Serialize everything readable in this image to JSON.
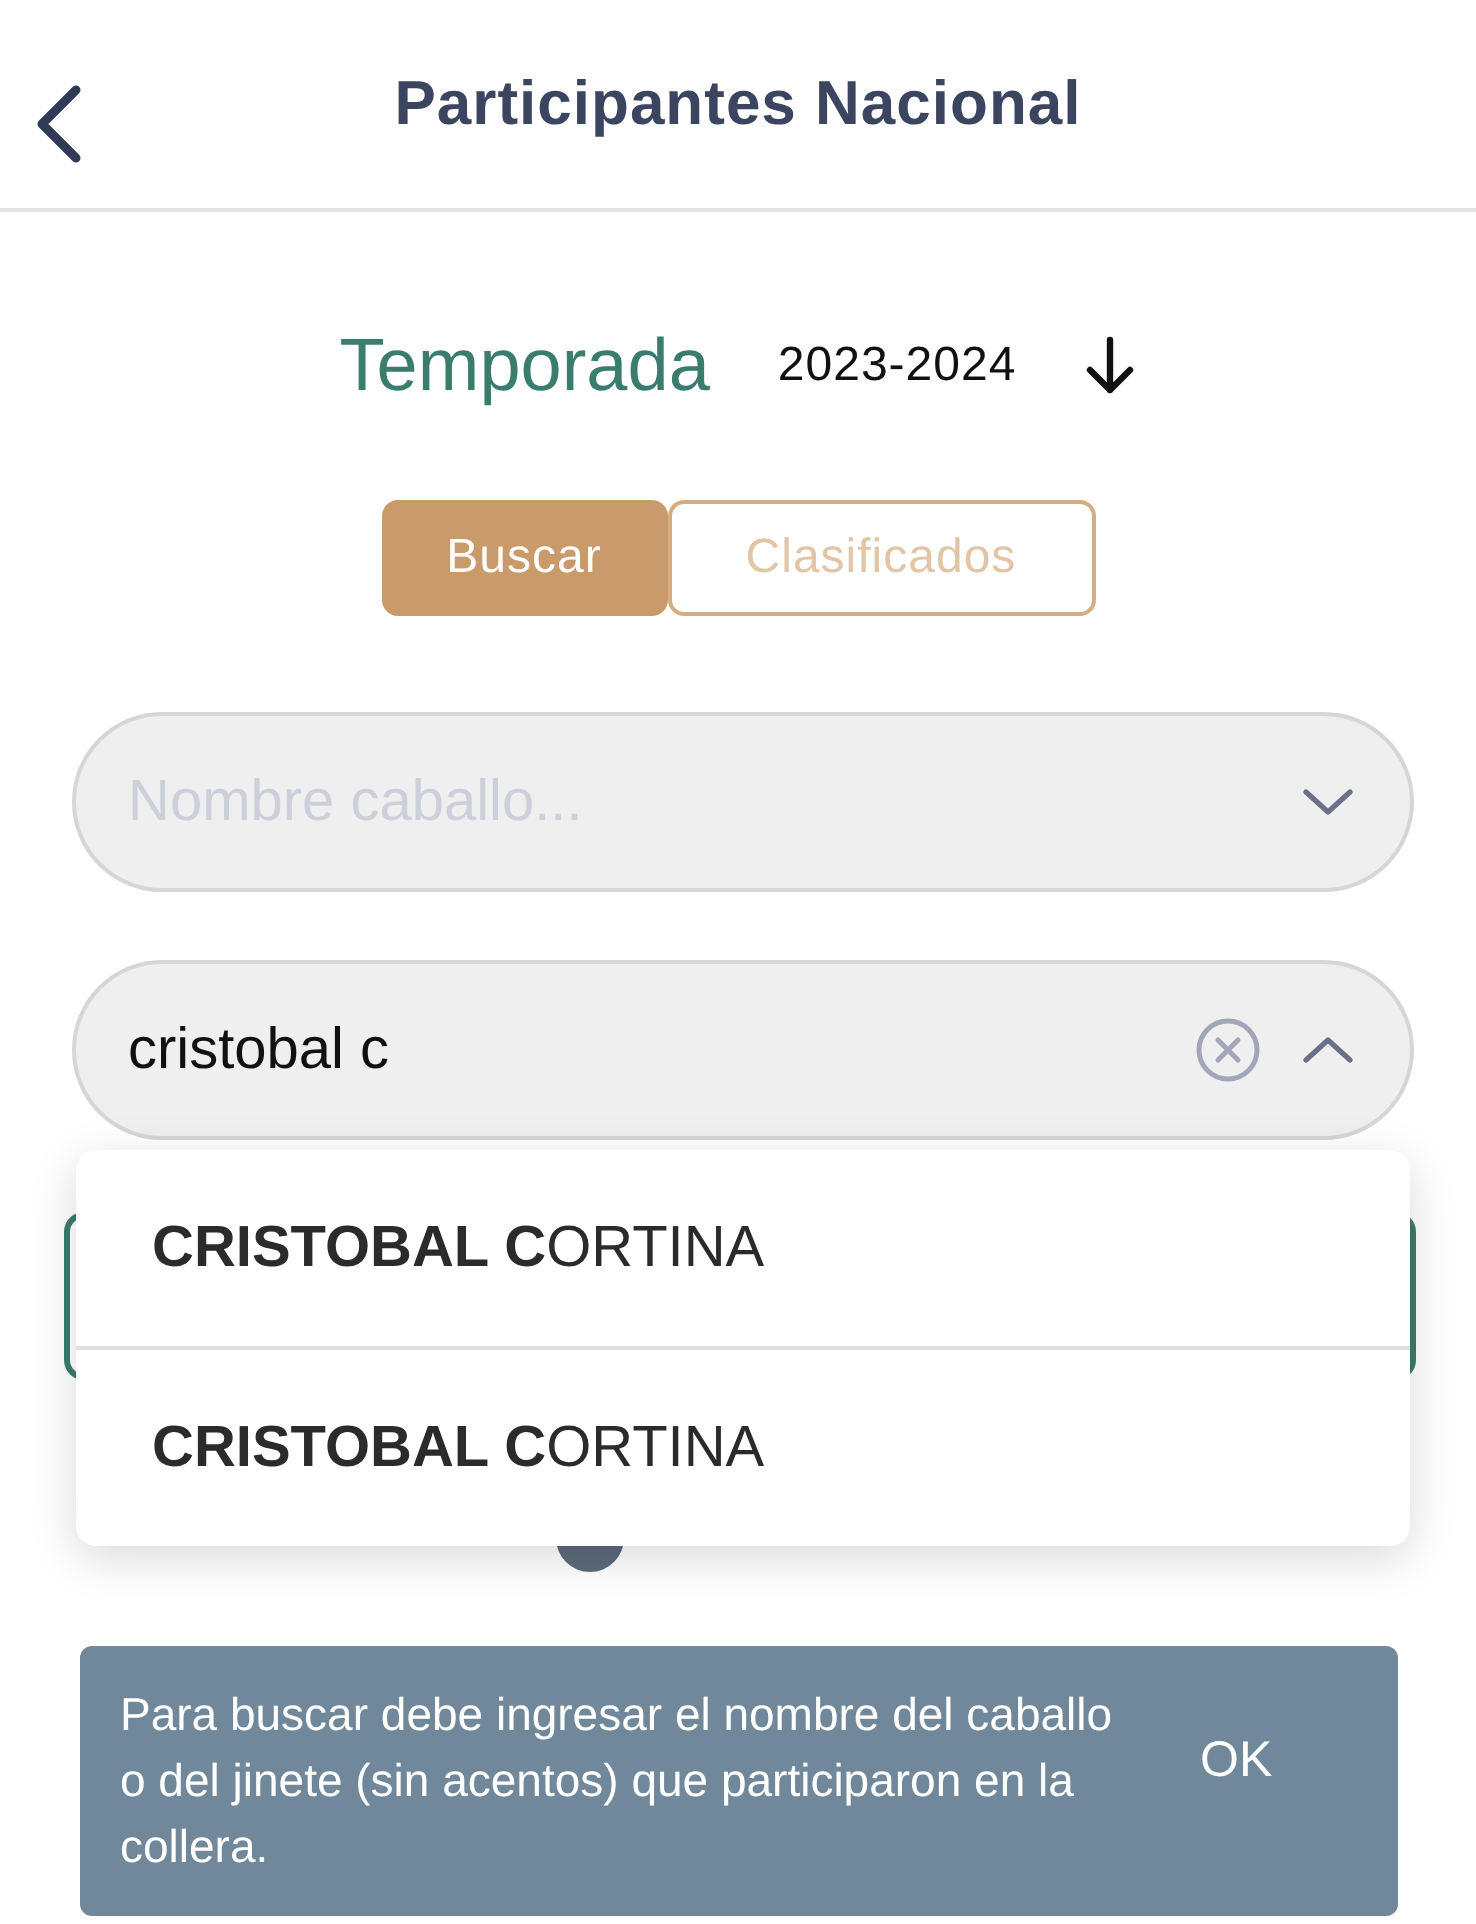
{
  "header": {
    "title": "Participantes Nacional"
  },
  "season": {
    "label": "Temporada",
    "value": "2023-2024"
  },
  "tabs": [
    {
      "label": "Buscar",
      "selected": true
    },
    {
      "label": "Clasificados",
      "selected": false
    }
  ],
  "horse_field": {
    "placeholder": "Nombre caballo...",
    "expanded": false
  },
  "rider_field": {
    "value": "cristobal c",
    "expanded": true
  },
  "suggestions": [
    "**CRISTOBAL C**ORTINA",
    "**CRISTOBAL C**ORTINA"
  ],
  "snackbar": {
    "message": "Para buscar debe ingresar el nombre del caballo o del jinete (sin acentos) que participaron en la collera.",
    "action": "OK"
  }
}
